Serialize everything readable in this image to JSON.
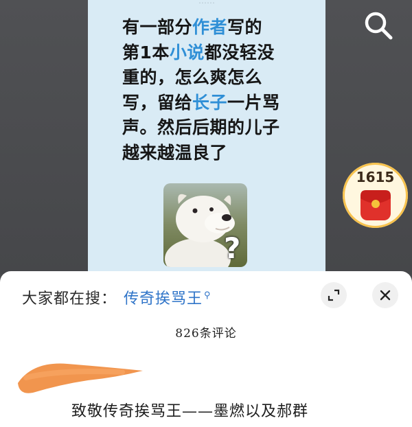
{
  "post": {
    "top_text": "……",
    "line1_a": "有一部分",
    "line1_b": "作者",
    "line1_c": "写的",
    "line2_a": "第1本",
    "line2_b": "小说",
    "line2_c": "都没轻没",
    "line3": "重的，怎么爽怎么",
    "line4_a": "写，留给",
    "line4_b": "长子",
    "line4_c": "一片骂",
    "line5": "声。然后后期的儿子",
    "line6": "越来越温良了",
    "meme_caption": "?"
  },
  "coin": {
    "count": "1615",
    "icon": "red-packet-icon"
  },
  "top_actions": {
    "search_icon": "search-icon"
  },
  "panel": {
    "search_label": "大家都在搜：",
    "search_term": "传奇挨骂王",
    "search_term_icon": "search-icon",
    "comment_count": "826条评论",
    "comment_text": "致敬传奇挨骂王——墨燃以及郝群"
  },
  "colors": {
    "accent_blue": "#2f8fd6",
    "post_bg": "#d9ebf5",
    "coin_red": "#e0312b",
    "redaction_orange": "#f08a3b"
  }
}
